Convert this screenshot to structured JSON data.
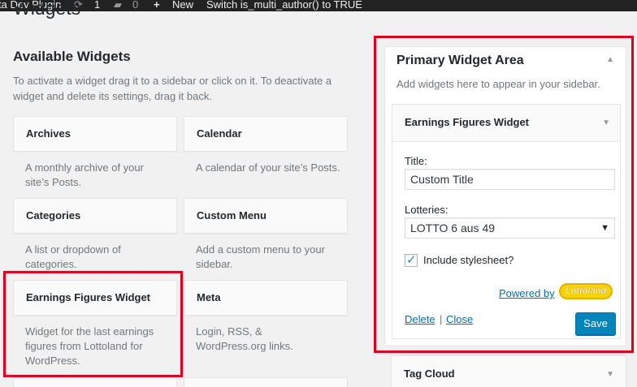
{
  "adminbar": {
    "site_name": "ta Dev Plugin",
    "updates_count": "1",
    "comments_count": "0",
    "new_label": "New",
    "custom_item": "Switch is_multi_author() to TRUE",
    "icons": [
      "refresh-icon",
      "comment-icon",
      "plus-icon"
    ]
  },
  "page": {
    "title": "Widgets"
  },
  "available": {
    "heading": "Available Widgets",
    "description": "To activate a widget drag it to a sidebar or click on it. To deactivate a widget and delete its settings, drag it back.",
    "widgets": [
      {
        "title": "Archives",
        "description": "A monthly archive of your site’s Posts."
      },
      {
        "title": "Calendar",
        "description": "A calendar of your site’s Posts."
      },
      {
        "title": "Categories",
        "description": "A list or dropdown of categories."
      },
      {
        "title": "Custom Menu",
        "description": "Add a custom menu to your sidebar."
      },
      {
        "title": "Earnings Figures Widget",
        "description": "Widget for the last earnings figures from Lottoland for WordPress."
      },
      {
        "title": "Meta",
        "description": "Login, RSS, & WordPress.org links."
      }
    ]
  },
  "sidebar": {
    "title": "Primary Widget Area",
    "description": "Add widgets here to appear in your sidebar.",
    "widget": {
      "title": "Earnings Figures Widget",
      "title_label": "Title:",
      "title_value": "Custom Title",
      "lotteries_label": "Lotteries:",
      "lotteries_value": "LOTTO 6 aus 49",
      "stylesheet_label": "Include stylesheet?",
      "stylesheet_checked": true,
      "powered_by": "Powered by",
      "logo_text": "Lottoland",
      "delete_label": "Delete",
      "separator": "|",
      "close_label": "Close",
      "save_label": "Save"
    }
  },
  "tag_cloud": {
    "title": "Tag Cloud"
  },
  "colors": {
    "highlight": "#e0001b",
    "primary_button": "#0085ba",
    "link": "#0073aa"
  }
}
